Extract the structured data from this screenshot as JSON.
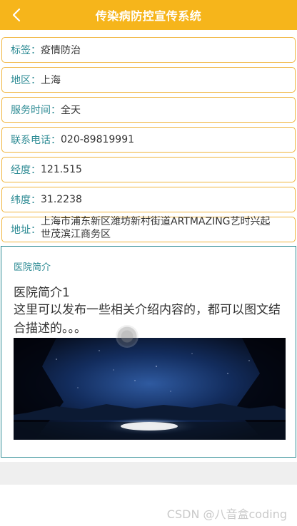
{
  "header": {
    "title": "传染病防控宣传系统"
  },
  "fields": [
    {
      "label": "标签：",
      "value": "疫情防治"
    },
    {
      "label": "地区：",
      "value": "上海"
    },
    {
      "label": "服务时间：",
      "value": "全天"
    },
    {
      "label": "联系电话：",
      "value": "020-89819991"
    },
    {
      "label": "经度：",
      "value": "121.515"
    },
    {
      "label": "纬度：",
      "value": "31.2238"
    },
    {
      "label": "地址：",
      "value": "上海市浦东新区潍坊新村街道ARTMAZING艺时兴起世茂滨江商务区"
    }
  ],
  "intro": {
    "label": "医院简介",
    "title": "医院简介1",
    "description": "这里可以发布一些相关介绍内容的，都可以图文结合描述的。。。"
  },
  "watermark": "CSDN @八音盒coding",
  "colors": {
    "header_bg": "#f6b51b",
    "label_teal": "#2b8a93",
    "row_border": "#f0b43c"
  },
  "icons": {
    "back": "chevron-left-icon"
  }
}
